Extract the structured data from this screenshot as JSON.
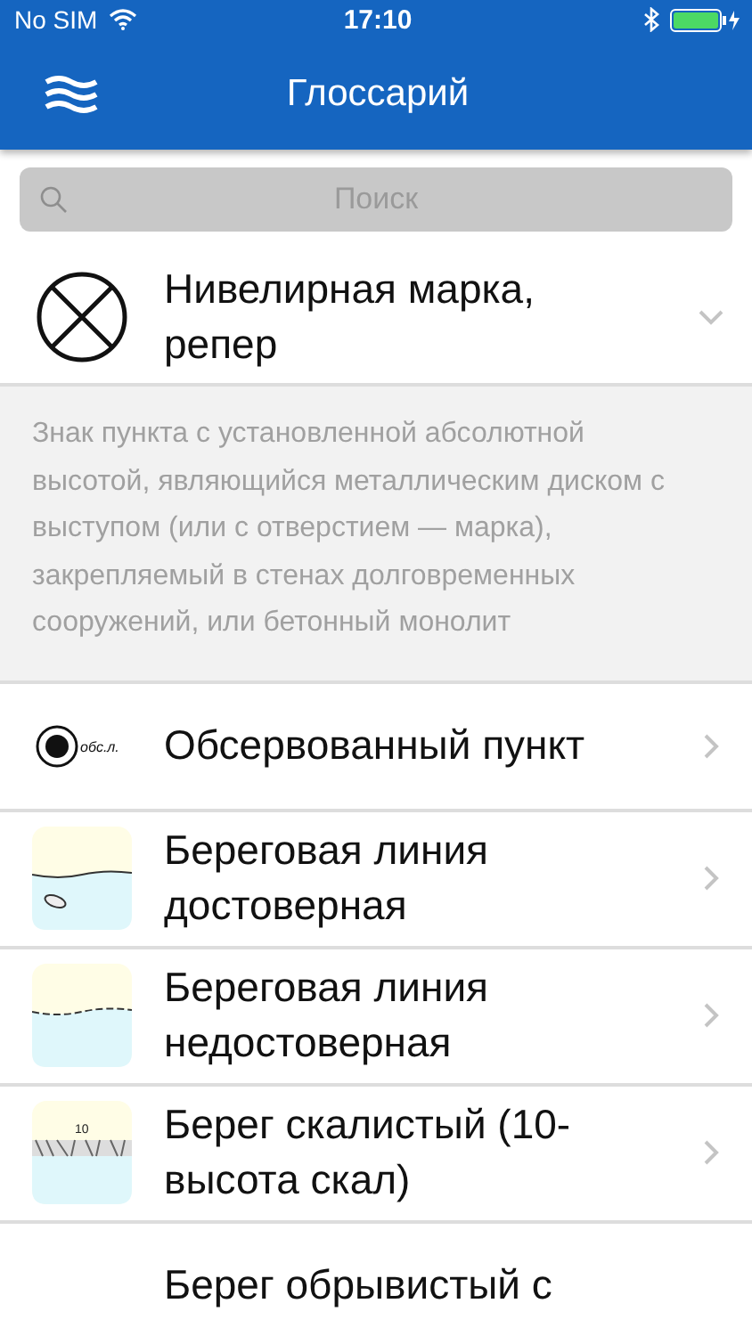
{
  "status_bar": {
    "carrier": "No SIM",
    "time": "17:10",
    "battery": {
      "level": 1.0
    }
  },
  "nav": {
    "title": "Глоссарий"
  },
  "search": {
    "placeholder": "Поиск"
  },
  "entries": [
    {
      "title": "Нивелирная марка, репер",
      "kind": "cross",
      "expanded": true,
      "description": "Знак пункта с установленной абсолютной высотой, являющийся металлическим диском с выступом (или с отверстием — марка), закрепляемый в стенах долговременных сооружений, или бетонный монолит"
    },
    {
      "title": "Обсервованный пункт",
      "kind": "point",
      "symbol_text": "обс.л.",
      "expanded": false
    },
    {
      "title": "Береговая линия достоверная",
      "kind": "solid",
      "expanded": false
    },
    {
      "title": "Береговая линия недостоверная",
      "kind": "dashed",
      "expanded": false
    },
    {
      "title": "Берег скалистый (10-высота скал)",
      "kind": "rocky",
      "symbol_text": "10",
      "expanded": false
    },
    {
      "title": "Берег обрывистый с",
      "kind": "blank"
    }
  ]
}
